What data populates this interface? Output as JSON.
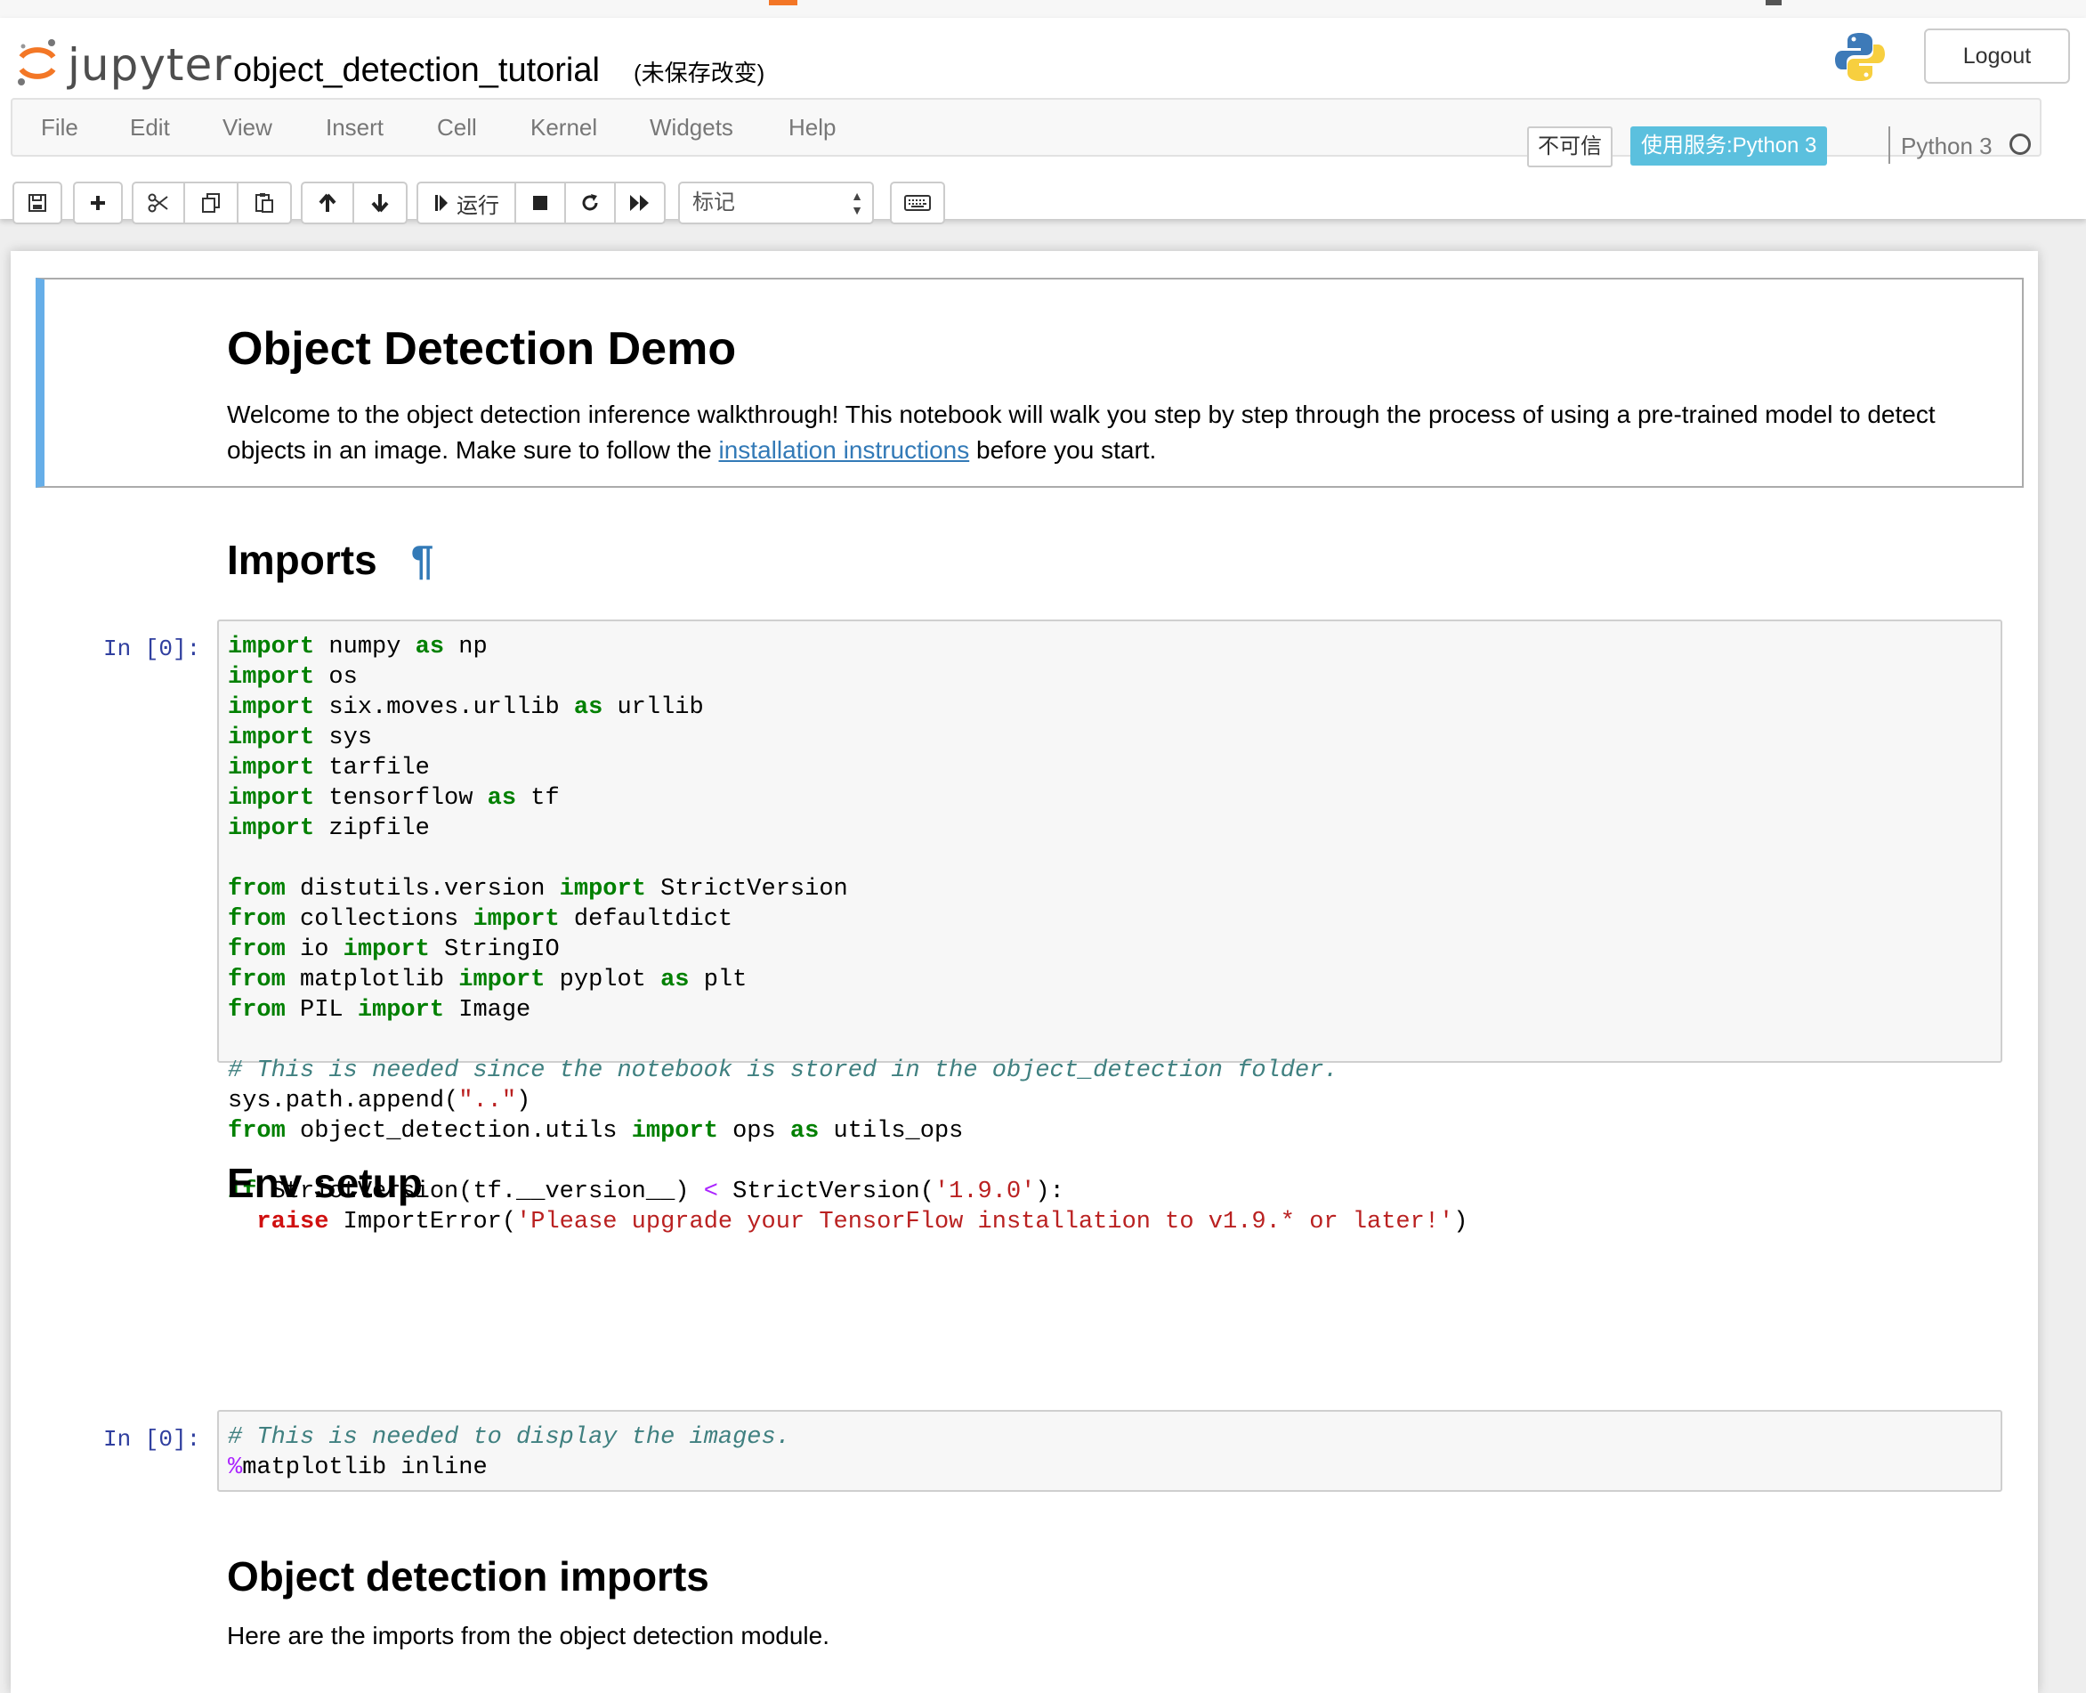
{
  "header": {
    "logo_text": "jupyter",
    "notebook_title": "object_detection_tutorial",
    "save_status": "(未保存改变)",
    "logout_label": "Logout"
  },
  "menubar": {
    "items": [
      "File",
      "Edit",
      "View",
      "Insert",
      "Cell",
      "Kernel",
      "Widgets",
      "Help"
    ],
    "trust_label": "不可信",
    "kernel_badge": "使用服务:Python 3",
    "kernel_name": "Python 3"
  },
  "toolbar": {
    "run_label": "运行",
    "cell_type": "标记",
    "icons": [
      "save-icon",
      "plus-icon",
      "cut-icon",
      "copy-icon",
      "paste-icon",
      "arrow-up-icon",
      "arrow-down-icon",
      "step-forward-icon",
      "stop-icon",
      "restart-icon",
      "fast-forward-icon",
      "keyboard-icon"
    ]
  },
  "cells": {
    "intro": {
      "title": "Object Detection Demo",
      "text_before": "Welcome to the object detection inference walkthrough! This notebook will walk you step by step through the process of using a pre-trained model to detect objects in an image. Make sure to follow the ",
      "link": "installation instructions",
      "text_after": " before you start."
    },
    "imports_heading": "Imports",
    "pilcrow": "¶",
    "code1_prompt": "In [0]:",
    "env_heading": "Env setup",
    "code2_prompt": "In [0]:",
    "od_heading": "Object detection imports",
    "od_text": "Here are the imports from the object detection module."
  },
  "code1_lines": [
    [
      [
        "kw",
        "import"
      ],
      [
        "t",
        " numpy "
      ],
      [
        "kw",
        "as"
      ],
      [
        "t",
        " np"
      ]
    ],
    [
      [
        "kw",
        "import"
      ],
      [
        "t",
        " os"
      ]
    ],
    [
      [
        "kw",
        "import"
      ],
      [
        "t",
        " six.moves.urllib "
      ],
      [
        "kw",
        "as"
      ],
      [
        "t",
        " urllib"
      ]
    ],
    [
      [
        "kw",
        "import"
      ],
      [
        "t",
        " sys"
      ]
    ],
    [
      [
        "kw",
        "import"
      ],
      [
        "t",
        " tarfile"
      ]
    ],
    [
      [
        "kw",
        "import"
      ],
      [
        "t",
        " tensorflow "
      ],
      [
        "kw",
        "as"
      ],
      [
        "t",
        " tf"
      ]
    ],
    [
      [
        "kw",
        "import"
      ],
      [
        "t",
        " zipfile"
      ]
    ],
    [],
    [
      [
        "kw",
        "from"
      ],
      [
        "t",
        " distutils.version "
      ],
      [
        "kw",
        "import"
      ],
      [
        "t",
        " StrictVersion"
      ]
    ],
    [
      [
        "kw",
        "from"
      ],
      [
        "t",
        " collections "
      ],
      [
        "kw",
        "import"
      ],
      [
        "t",
        " defaultdict"
      ]
    ],
    [
      [
        "kw",
        "from"
      ],
      [
        "t",
        " io "
      ],
      [
        "kw",
        "import"
      ],
      [
        "t",
        " StringIO"
      ]
    ],
    [
      [
        "kw",
        "from"
      ],
      [
        "t",
        " matplotlib "
      ],
      [
        "kw",
        "import"
      ],
      [
        "t",
        " pyplot "
      ],
      [
        "kw",
        "as"
      ],
      [
        "t",
        " plt"
      ]
    ],
    [
      [
        "kw",
        "from"
      ],
      [
        "t",
        " PIL "
      ],
      [
        "kw",
        "import"
      ],
      [
        "t",
        " Image"
      ]
    ],
    [],
    [
      [
        "com",
        "# This is needed since the notebook is stored in the object_detection folder."
      ]
    ],
    [
      [
        "t",
        "sys.path.append("
      ],
      [
        "str",
        "\"..\""
      ],
      [
        "t",
        ")"
      ]
    ],
    [
      [
        "kw",
        "from"
      ],
      [
        "t",
        " object_detection.utils "
      ],
      [
        "kw",
        "import"
      ],
      [
        "t",
        " ops "
      ],
      [
        "kw",
        "as"
      ],
      [
        "t",
        " utils_ops"
      ]
    ],
    [],
    [
      [
        "kw",
        "if"
      ],
      [
        "t",
        " StrictVersion(tf.__version__) "
      ],
      [
        "op",
        "<"
      ],
      [
        "t",
        " StrictVersion("
      ],
      [
        "str",
        "'1.9.0'"
      ],
      [
        "t",
        "):"
      ]
    ],
    [
      [
        "t",
        "  "
      ],
      [
        "kw-raise",
        "raise"
      ],
      [
        "t",
        " ImportError("
      ],
      [
        "str",
        "'Please upgrade your TensorFlow installation to v1.9.* or later!'"
      ],
      [
        "t",
        ")"
      ]
    ]
  ],
  "code2_lines": [
    [
      [
        "com",
        "# This is needed to display the images."
      ]
    ],
    [
      [
        "op",
        "%"
      ],
      [
        "t",
        "matplotlib inline"
      ]
    ]
  ]
}
